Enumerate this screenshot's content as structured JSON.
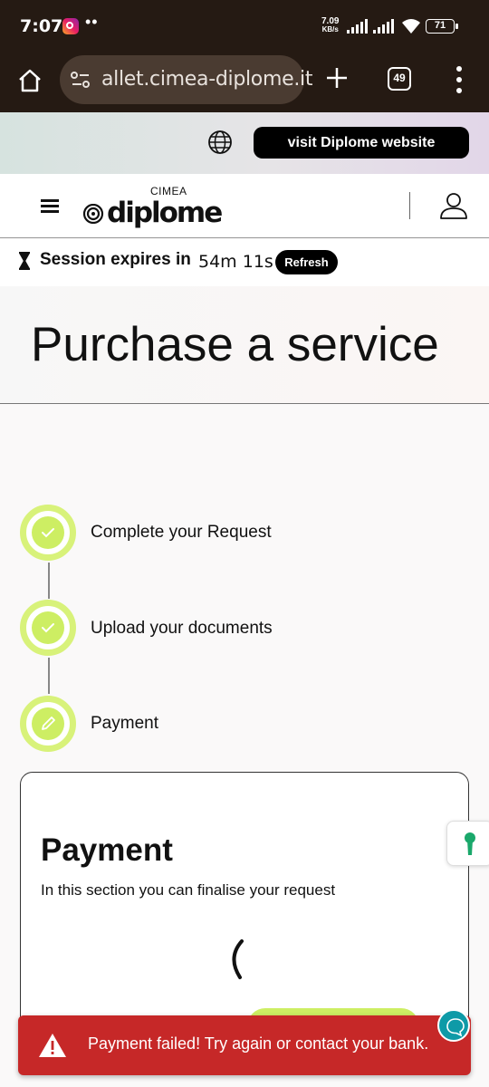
{
  "status_bar": {
    "time": "7:07",
    "dots": "••",
    "net_speed_value": "7.09",
    "net_speed_unit": "KB/s",
    "battery": "71"
  },
  "browser": {
    "url": "allet.cimea-diplome.it",
    "tab_count": "49"
  },
  "banner": {
    "visit_label": "visit Diplome website"
  },
  "header": {
    "logo_small": "CIMEA",
    "logo_word": "diplome"
  },
  "session": {
    "label": "Session expires in",
    "time_left": "54m 11s",
    "refresh_label": "Refresh"
  },
  "page": {
    "title": "Purchase a service"
  },
  "steps": [
    {
      "label": "Complete your Request",
      "state": "done"
    },
    {
      "label": "Upload your documents",
      "state": "done"
    },
    {
      "label": "Payment",
      "state": "current"
    }
  ],
  "payment_card": {
    "title": "Payment",
    "subtitle": "In this section you can finalise your request"
  },
  "alert": {
    "message": "Payment failed! Try again or contact your bank."
  },
  "colors": {
    "accent_lime": "#cdee63",
    "alert_red": "#c62828",
    "browser_dark": "#251a13",
    "chat_teal": "#0e9aa7",
    "keyhole_green": "#1aa86b"
  }
}
